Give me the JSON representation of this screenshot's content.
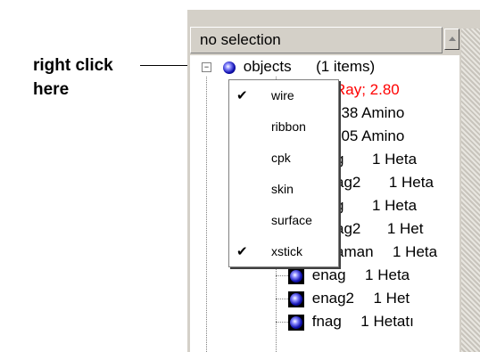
{
  "callout": {
    "line1": "right click",
    "line2": "here"
  },
  "panel": {
    "header_label": "no selection"
  },
  "tree": {
    "root": {
      "name": "objects",
      "count": "(1 items)"
    },
    "rows": [
      {
        "name": "",
        "desc": "X-Ray; 2.80",
        "red": true
      },
      {
        "name": "",
        "desc": "338 Amino"
      },
      {
        "name": "",
        "desc": "305 Amino"
      },
      {
        "name": "g",
        "desc": "1 Heta"
      },
      {
        "name": "ag2",
        "desc": "1 Heta"
      },
      {
        "name": "g",
        "desc": "1 Heta"
      },
      {
        "name": "ag2",
        "desc": "1 Het"
      },
      {
        "name": "aman",
        "desc": "1 Heta"
      },
      {
        "name": "enag",
        "desc": "1 Heta"
      },
      {
        "name": "enag2",
        "desc": "1 Het"
      },
      {
        "name": "fnag",
        "desc": "1 Hetatı"
      }
    ]
  },
  "context_menu": {
    "items": [
      {
        "label": "wire",
        "checked": true
      },
      {
        "label": "ribbon",
        "checked": false
      },
      {
        "label": "cpk",
        "checked": false
      },
      {
        "label": "skin",
        "checked": false
      },
      {
        "label": "surface",
        "checked": false
      },
      {
        "label": "xstick",
        "checked": true
      }
    ],
    "check_glyph": "✔"
  }
}
